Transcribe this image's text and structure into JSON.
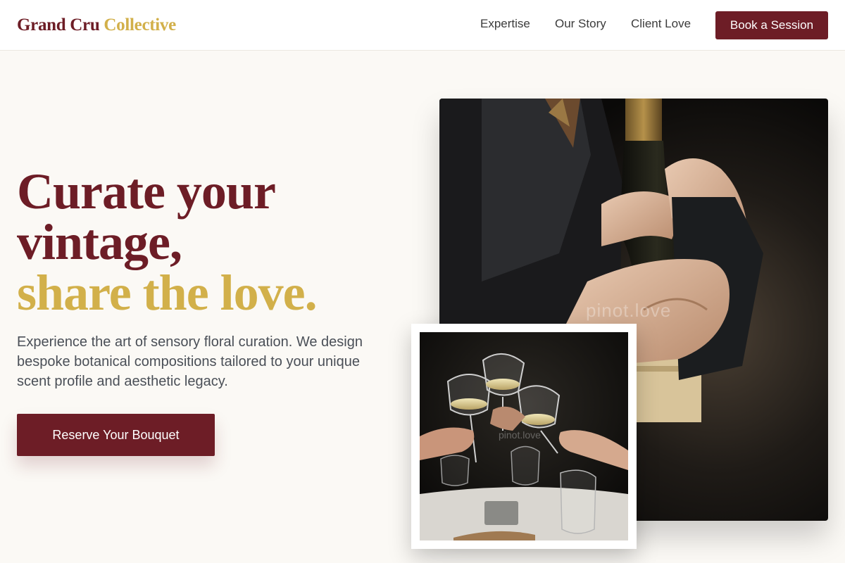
{
  "header": {
    "logo_part1": "Grand Cru",
    "logo_part2": "Collective",
    "nav": [
      "Expertise",
      "Our Story",
      "Client Love"
    ],
    "cta": "Book a Session"
  },
  "hero": {
    "headline_line1": "Curate your",
    "headline_line2": "vintage,",
    "headline_line3": "share the love.",
    "description": "Experience the art of sensory floral curation. We design bespoke botanical compositions tailored to your unique scent profile and aesthetic legacy.",
    "cta": "Reserve Your Bouquet"
  },
  "images": {
    "main_watermark": "pinot.love",
    "small_watermark": "pinot.love"
  },
  "colors": {
    "burgundy": "#6d1d26",
    "gold": "#d2b04a",
    "background": "#fbf9f5"
  }
}
